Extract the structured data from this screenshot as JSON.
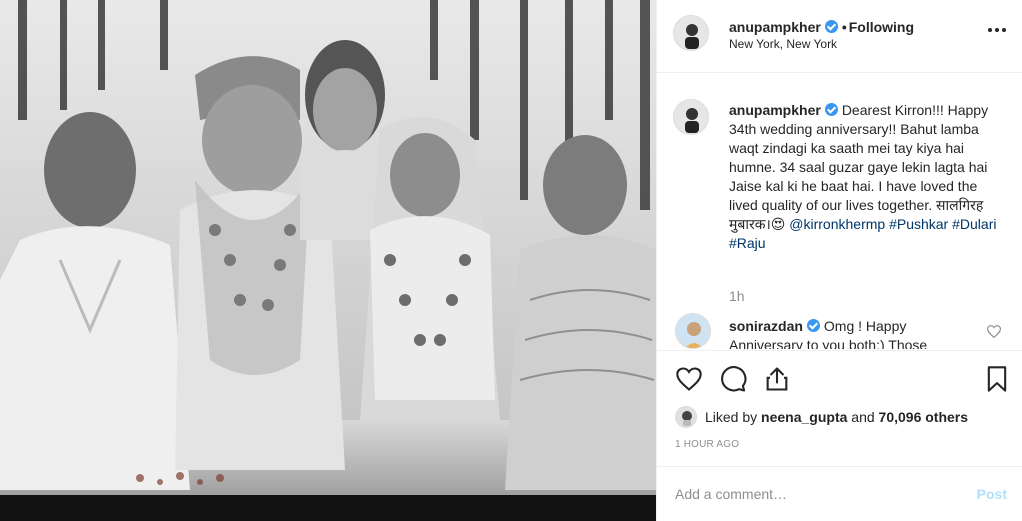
{
  "post": {
    "photo_description": "Black and white wedding photograph",
    "author": {
      "username": "anupampkher",
      "verified": true,
      "follow_separator": "•",
      "follow_status": "Following",
      "location": "New York, New York"
    },
    "caption": {
      "username": "anupampkher",
      "text": "Dearest Kirron!!! Happy 34th wedding anniversary!! Bahut lamba waqt zindagi ka saath mei tay kiya hai humne. 34 saal guzar gaye lekin lagta hai Jaise kal ki he baat hai. I have loved the lived quality of our lives together. सालगिरह मुबारक।",
      "emoji": "😍",
      "mention": "@kirronkhermp",
      "hashtags": [
        "#Pushkar",
        "#Dulari",
        "#Raju"
      ],
      "time": "1h"
    },
    "comments": [
      {
        "username": "sonirazdan",
        "verified": true,
        "text": "Omg ! Happy Anniversary to you both:) Those"
      }
    ],
    "likes": {
      "prefix": "Liked by",
      "user": "neena_gupta",
      "connector": "and",
      "others": "70,096 others"
    },
    "timestamp": "1 HOUR AGO",
    "add_comment": {
      "placeholder": "Add a comment…",
      "post_label": "Post"
    }
  },
  "icons": {
    "more": "more-options-icon",
    "like": "heart-icon",
    "comment": "comment-icon",
    "share": "share-icon",
    "save": "bookmark-icon"
  },
  "colors": {
    "link": "#003569",
    "verified": "#3897f0",
    "post_button": "#b2dffc",
    "muted": "#8e8e8e"
  }
}
